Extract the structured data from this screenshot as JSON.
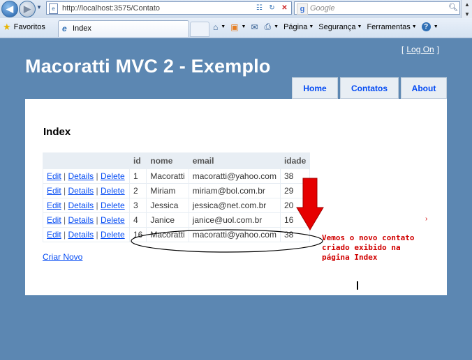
{
  "browser": {
    "url": "http://localhost:3575/Contato",
    "search_placeholder": "Google",
    "favorites_label": "Favoritos",
    "tab_title": "Index",
    "commands": {
      "pagina": "Página",
      "seguranca": "Segurança",
      "ferramentas": "Ferramentas"
    }
  },
  "site": {
    "title": "Macoratti MVC 2 - Exemplo",
    "login_open": "[",
    "login_link": "Log On",
    "login_close": "]",
    "menu": [
      "Home",
      "Contatos",
      "About"
    ]
  },
  "page": {
    "heading": "Index",
    "columns": [
      "",
      "id",
      "nome",
      "email",
      "idade"
    ],
    "action_labels": {
      "edit": "Edit",
      "details": "Details",
      "delete": "Delete",
      "separator": "|"
    },
    "rows": [
      {
        "id": "1",
        "nome": "Macoratti",
        "email": "macoratti@yahoo.com",
        "idade": "38"
      },
      {
        "id": "2",
        "nome": "Miriam",
        "email": "miriam@bol.com.br",
        "idade": "29"
      },
      {
        "id": "3",
        "nome": "Jessica",
        "email": "jessica@net.com.br",
        "idade": "20"
      },
      {
        "id": "4",
        "nome": "Janice",
        "email": "janice@uol.com.br",
        "idade": "16"
      },
      {
        "id": "16",
        "nome": "Macoratti",
        "email": "macoratti@yahoo.com",
        "idade": "38"
      }
    ],
    "create_link": "Criar Novo"
  },
  "annotation": {
    "text": "Vemos o novo contato\ncriado exibido na\npágina Index",
    "color": "#d00000"
  },
  "colors": {
    "page_background": "#5c87b2",
    "link": "#034af3",
    "header_cell": "#e8eef4"
  }
}
